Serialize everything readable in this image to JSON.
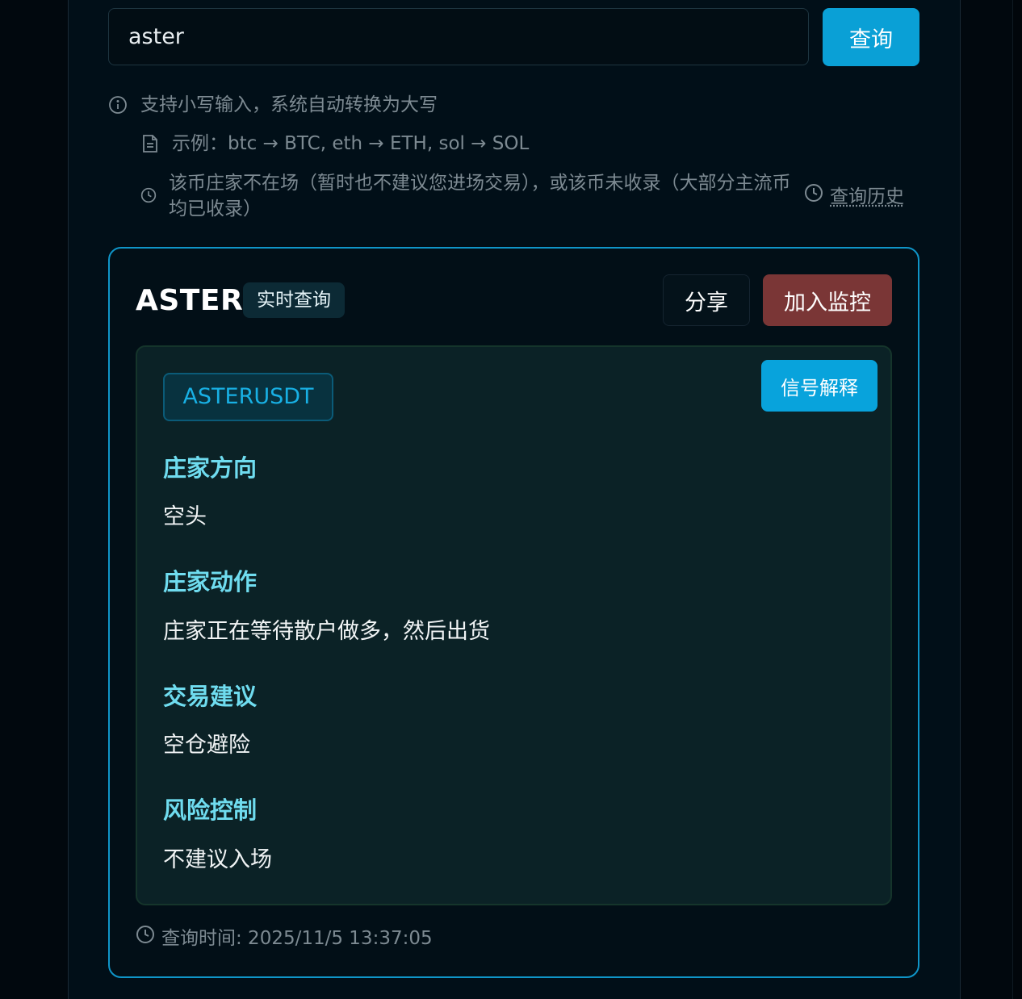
{
  "search": {
    "value": "aster",
    "button_label": "查询"
  },
  "hints": {
    "lowercase": "支持小写输入，系统自动转换为大写",
    "example": "示例：btc → BTC, eth → ETH, sol → SOL",
    "not_listed": "该币庄家不在场（暂时也不建议您进场交易），或该币未收录（大部分主流币均已收录）",
    "history_label": "查询历史"
  },
  "result": {
    "symbol": "ASTER",
    "badge": "实时查询",
    "share_label": "分享",
    "monitor_label": "加入监控",
    "pair": "ASTERUSDT",
    "explain_label": "信号解释",
    "sections": [
      {
        "title": "庄家方向",
        "value": "空头"
      },
      {
        "title": "庄家动作",
        "value": "庄家正在等待散户做多，然后出货"
      },
      {
        "title": "交易建议",
        "value": "空仓避险"
      },
      {
        "title": "风险控制",
        "value": "不建议入场"
      }
    ],
    "query_time": "查询时间: 2025/11/5 13:37:05"
  },
  "colors": {
    "accent": "#0aa0d6",
    "monitor": "#7a3636",
    "section_title": "#6fdcef"
  }
}
